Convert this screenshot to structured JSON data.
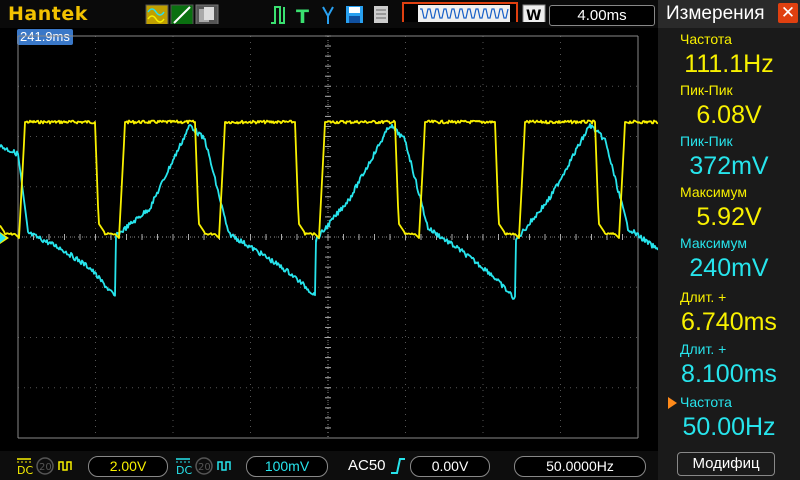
{
  "header": {
    "brand": "Hantek",
    "timebase": "4.00ms",
    "trigger_position": "241.9ms"
  },
  "panel": {
    "title": "Измерения",
    "measurements": [
      {
        "label": "Частота",
        "value": "111.1Hz",
        "color": "#f8f000"
      },
      {
        "label": "Пик-Пик",
        "value": "6.08V",
        "color": "#f8f000"
      },
      {
        "label": "Пик-Пик",
        "value": "372mV",
        "color": "#27e4ec"
      },
      {
        "label": "Максимум",
        "value": "5.92V",
        "color": "#f8f000"
      },
      {
        "label": "Максимум",
        "value": "240mV",
        "color": "#27e4ec"
      },
      {
        "label": "Длит.  +",
        "value": "6.740ms",
        "color": "#f8f000"
      },
      {
        "label": "Длит.  +",
        "value": "8.100ms",
        "color": "#27e4ec"
      },
      {
        "label": "Частота",
        "value": "50.00Hz",
        "color": "#27e4ec"
      }
    ],
    "modify_label": "Модифиц"
  },
  "footer": {
    "ch1_coupling": "DC",
    "ch1_bw": "20",
    "ch1_scale": "2.00V",
    "ch2_coupling": "DC",
    "ch2_bw": "20",
    "ch2_scale": "100mV",
    "trigger_mode": "AC50",
    "trigger_level": "0.00V",
    "trigger_freq": "50.0000Hz"
  },
  "colors": {
    "ch1": "#f8f000",
    "ch2": "#27e4ec",
    "brand": "#f2c200"
  }
}
